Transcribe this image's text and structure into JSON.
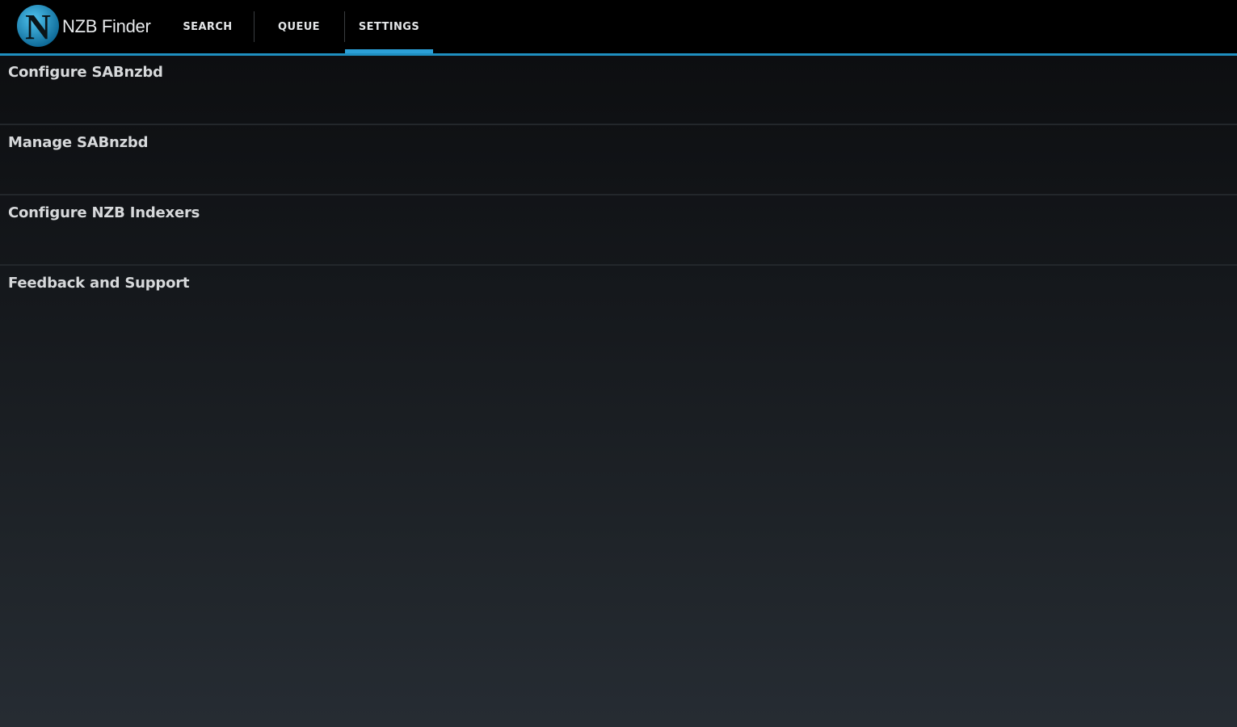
{
  "app": {
    "title": "NZB Finder",
    "logo_letter": "N"
  },
  "tabs": [
    {
      "label": "SEARCH",
      "selected": false
    },
    {
      "label": "QUEUE",
      "selected": false
    },
    {
      "label": "SETTINGS",
      "selected": true
    }
  ],
  "settings": {
    "items": [
      {
        "label": "Configure SABnzbd"
      },
      {
        "label": "Manage SABnzbd"
      },
      {
        "label": "Configure NZB Indexers"
      },
      {
        "label": "Feedback and Support"
      }
    ]
  },
  "colors": {
    "accent": "#2b9fd6",
    "action_bar": "#000000",
    "text_primary": "#d7d9db"
  }
}
